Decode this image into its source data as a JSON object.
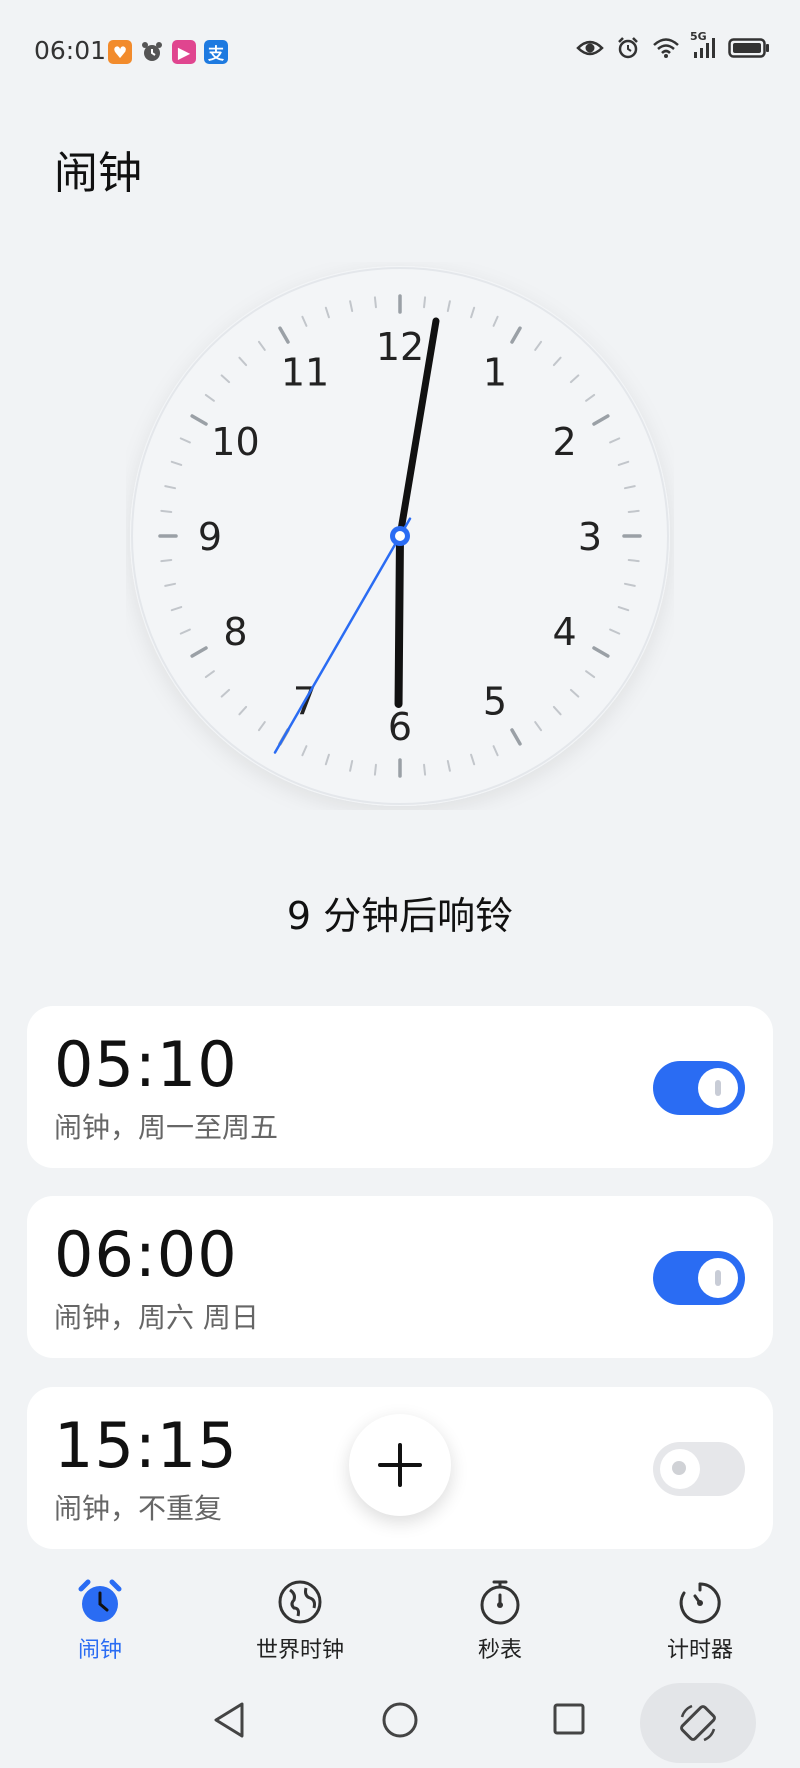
{
  "status_bar": {
    "time": "06:01",
    "notification_icons": [
      "shopping-app-icon",
      "alarm-icon",
      "video-app-icon",
      "alipay-icon"
    ],
    "network": "5G"
  },
  "page": {
    "title": "闹钟"
  },
  "clock": {
    "numerals": [
      "12",
      "1",
      "2",
      "3",
      "4",
      "5",
      "6",
      "7",
      "8",
      "9",
      "10",
      "11"
    ],
    "hour": 6,
    "minute": 1,
    "second": 35,
    "second_hand_color": "#2a6cf3"
  },
  "next_alarm_text": "9 分钟后响铃",
  "alarms": [
    {
      "time": "05:10",
      "label": "闹钟，周一至周五",
      "enabled": true
    },
    {
      "time": "06:00",
      "label": "闹钟，周六 周日",
      "enabled": true
    },
    {
      "time": "15:15",
      "label": "闹钟，不重复",
      "enabled": false
    }
  ],
  "nav": {
    "items": [
      {
        "label": "闹钟",
        "icon": "alarm-clock-icon",
        "active": true
      },
      {
        "label": "世界时钟",
        "icon": "globe-icon",
        "active": false
      },
      {
        "label": "秒表",
        "icon": "stopwatch-icon",
        "active": false
      },
      {
        "label": "计时器",
        "icon": "timer-icon",
        "active": false
      }
    ]
  },
  "colors": {
    "accent": "#2a6cf3",
    "background": "#f1f3f5",
    "card": "#ffffff"
  }
}
